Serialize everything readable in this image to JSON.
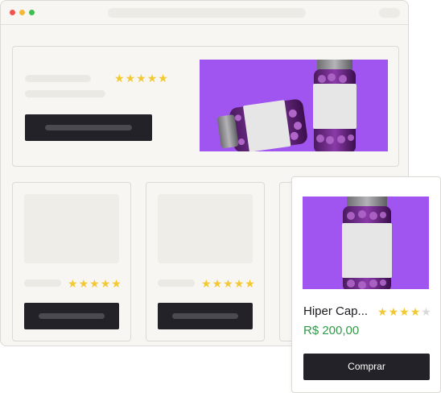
{
  "colors": {
    "accent_purple": "#a054f0",
    "button_dark": "#232228",
    "price_green": "#2f9a47",
    "star_gold": "#f2c933",
    "dot_red": "#f0554d",
    "dot_yellow": "#f5b83a",
    "dot_green": "#3fbf4f"
  },
  "hero": {
    "rating_stars": 5
  },
  "grid_cards": [
    {
      "rating_stars": 5
    },
    {
      "rating_stars": 5
    }
  ],
  "product_popup": {
    "name": "Hiper Cap...",
    "price": "R$ 200,00",
    "rating_stars": 4,
    "rating_max": 5,
    "buy_label": "Comprar"
  },
  "icons": {
    "star": "star-icon",
    "bottle": "supplement-bottle-icon"
  }
}
